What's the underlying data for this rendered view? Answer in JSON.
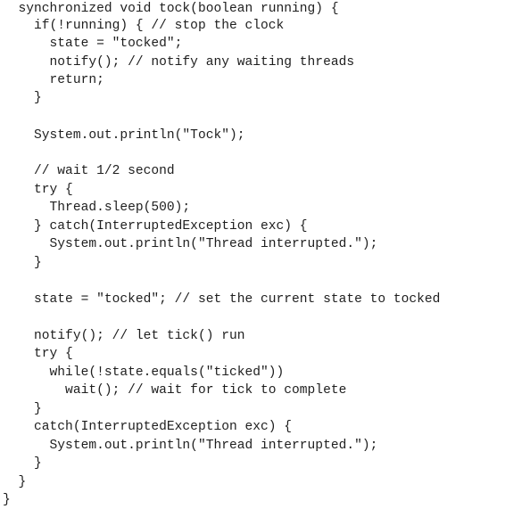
{
  "code": {
    "lines": [
      "  synchronized void tock(boolean running) {",
      "    if(!running) { // stop the clock",
      "      state = \"tocked\";",
      "      notify(); // notify any waiting threads",
      "      return;",
      "    }",
      "",
      "    System.out.println(\"Tock\");",
      "",
      "    // wait 1/2 second",
      "    try {",
      "      Thread.sleep(500);",
      "    } catch(InterruptedException exc) {",
      "      System.out.println(\"Thread interrupted.\");",
      "    }",
      "",
      "    state = \"tocked\"; // set the current state to tocked",
      "",
      "    notify(); // let tick() run",
      "    try {",
      "      while(!state.equals(\"ticked\"))",
      "        wait(); // wait for tick to complete",
      "    }",
      "    catch(InterruptedException exc) {",
      "      System.out.println(\"Thread interrupted.\");",
      "    }",
      "  }",
      "}"
    ]
  }
}
